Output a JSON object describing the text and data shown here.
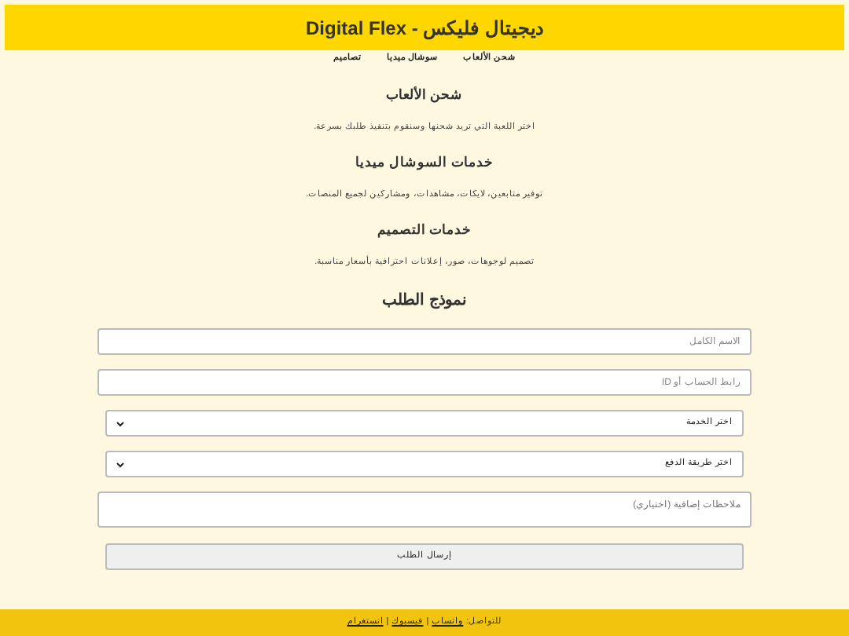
{
  "header": {
    "title": "ديجيتال فليكس - Digital Flex"
  },
  "nav": [
    {
      "label": "شحن الألعاب"
    },
    {
      "label": "سوشال ميديا"
    },
    {
      "label": "تصاميم"
    }
  ],
  "sections": [
    {
      "heading": "شحن الألعاب",
      "text": "اختر اللعبة التي تريد شحنها وسنقوم بتنفيذ طلبك بسرعة."
    },
    {
      "heading": "خدمات السوشال ميديا",
      "text": "توفير متابعين، لايكات، مشاهدات، ومشاركين لجميع المنصات."
    },
    {
      "heading": "خدمات التصميم",
      "text": "تصميم لوجوهات، صور، إعلانات احترافية بأسعار مناسبة."
    }
  ],
  "form": {
    "title": "نموذج الطلب",
    "fields": [
      {
        "kind": "input",
        "placeholder": "الاسم الكامل"
      },
      {
        "kind": "input",
        "placeholder": "رابط الحساب أو ID"
      },
      {
        "kind": "select",
        "value": "اختر الخدمة"
      },
      {
        "kind": "select",
        "value": "اختر طريقة الدفع"
      },
      {
        "kind": "textarea",
        "placeholder": "ملاحظات إضافية (اختياري)"
      }
    ],
    "submit": "إرسال الطلب"
  },
  "footer": {
    "label": "للتواصل:",
    "items": [
      {
        "kind": "link",
        "text": "واتساب"
      },
      {
        "kind": "separator",
        "text": "|"
      },
      {
        "kind": "link",
        "text": "فيسبوك"
      },
      {
        "kind": "separator",
        "text": "|"
      },
      {
        "kind": "link",
        "text": "انستغرام"
      }
    ]
  }
}
